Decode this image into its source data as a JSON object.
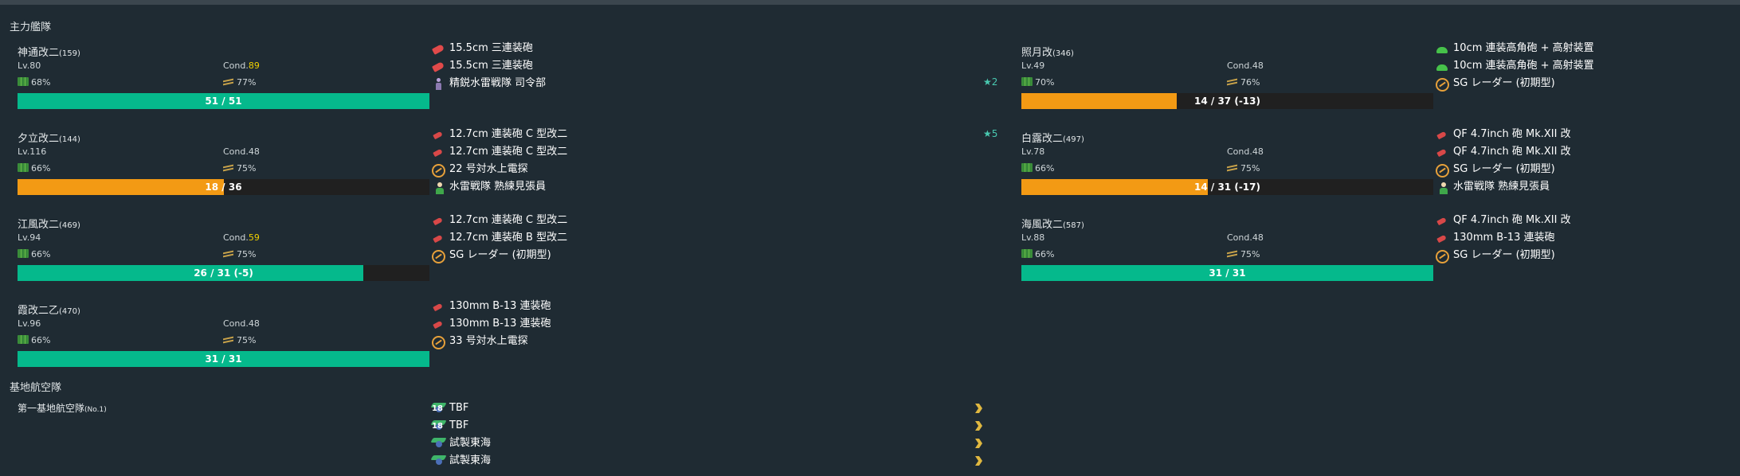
{
  "sections": {
    "main_fleet": "主力艦隊",
    "base_air": "基地航空隊"
  },
  "colors": {
    "hp_green": "#05b98c",
    "hp_orange": "#f39a14",
    "sparkle_yellow": "#f0d000",
    "proficiency_chevron": "#e0b840"
  },
  "ships": [
    {
      "name": "神通改二",
      "id": "(159)",
      "lv": "Lv.80",
      "cond_label": "Cond.",
      "cond": "89",
      "fuel": "68%",
      "ammo": "77%",
      "hp_text": "51 / 51",
      "hp_ratio": 1.0,
      "hp_color": "green",
      "equip": [
        {
          "icon": "main-gun-icon",
          "name": "15.5cm 三連装砲"
        },
        {
          "icon": "main-gun-icon",
          "name": "15.5cm 三連装砲"
        },
        {
          "icon": "fleet-command-icon",
          "name": "精鋭水雷戦隊 司令部"
        }
      ],
      "star": "★2"
    },
    {
      "name": "夕立改二",
      "id": "(144)",
      "lv": "Lv.116",
      "cond_label": "Cond.",
      "cond": "48",
      "fuel": "66%",
      "ammo": "75%",
      "hp_text": "18 / 36",
      "hp_ratio": 0.5,
      "hp_color": "orange",
      "equip": [
        {
          "icon": "small-gun-icon",
          "name": "12.7cm 連装砲 C 型改二"
        },
        {
          "icon": "small-gun-icon",
          "name": "12.7cm 連装砲 C 型改二"
        },
        {
          "icon": "radar-icon",
          "name": "22 号対水上電探"
        },
        {
          "icon": "lookout-icon",
          "name": "水雷戦隊 熟練見張員"
        }
      ],
      "star": "★5"
    },
    {
      "name": "江風改二",
      "id": "(469)",
      "lv": "Lv.94",
      "cond_label": "Cond.",
      "cond": "59",
      "fuel": "66%",
      "ammo": "75%",
      "hp_text": "26 / 31 (-5)",
      "hp_ratio": 0.839,
      "hp_color": "green",
      "equip": [
        {
          "icon": "small-gun-icon",
          "name": "12.7cm 連装砲 C 型改二"
        },
        {
          "icon": "small-gun-icon",
          "name": "12.7cm 連装砲 B 型改二"
        },
        {
          "icon": "radar-icon",
          "name": "SG レーダー (初期型)"
        }
      ]
    },
    {
      "name": "霞改二乙",
      "id": "(470)",
      "lv": "Lv.96",
      "cond_label": "Cond.",
      "cond": "48",
      "fuel": "66%",
      "ammo": "75%",
      "hp_text": "31 / 31",
      "hp_ratio": 1.0,
      "hp_color": "green",
      "equip": [
        {
          "icon": "small-gun-icon",
          "name": "130mm B-13 連装砲"
        },
        {
          "icon": "small-gun-icon",
          "name": "130mm B-13 連装砲"
        },
        {
          "icon": "radar-icon",
          "name": "33 号対水上電探"
        }
      ]
    },
    {
      "name": "照月改",
      "id": "(346)",
      "lv": "Lv.49",
      "cond_label": "Cond.",
      "cond": "48",
      "fuel": "70%",
      "ammo": "76%",
      "hp_text": "14 / 37 (-13)",
      "hp_ratio": 0.378,
      "hp_color": "orange",
      "equip": [
        {
          "icon": "aa-gun-icon",
          "name": "10cm 連装高角砲 + 高射装置"
        },
        {
          "icon": "aa-gun-icon",
          "name": "10cm 連装高角砲 + 高射装置"
        },
        {
          "icon": "radar-icon",
          "name": "SG レーダー (初期型)"
        }
      ]
    },
    {
      "name": "白露改二",
      "id": "(497)",
      "lv": "Lv.78",
      "cond_label": "Cond.",
      "cond": "48",
      "fuel": "66%",
      "ammo": "75%",
      "hp_text": "14 / 31 (-17)",
      "hp_ratio": 0.452,
      "hp_color": "orange",
      "equip": [
        {
          "icon": "small-gun-icon",
          "name": "QF 4.7inch 砲 Mk.XII 改"
        },
        {
          "icon": "small-gun-icon",
          "name": "QF 4.7inch 砲 Mk.XII 改"
        },
        {
          "icon": "radar-icon",
          "name": "SG レーダー (初期型)"
        },
        {
          "icon": "lookout-icon",
          "name": "水雷戦隊 熟練見張員"
        }
      ]
    },
    {
      "name": "海風改二",
      "id": "(587)",
      "lv": "Lv.88",
      "cond_label": "Cond.",
      "cond": "48",
      "fuel": "66%",
      "ammo": "75%",
      "hp_text": "31 / 31",
      "hp_ratio": 1.0,
      "hp_color": "green",
      "equip": [
        {
          "icon": "small-gun-icon",
          "name": "QF 4.7inch 砲 Mk.XII 改"
        },
        {
          "icon": "small-gun-icon",
          "name": "130mm B-13 連装砲"
        },
        {
          "icon": "radar-icon",
          "name": "SG レーダー (初期型)"
        }
      ]
    }
  ],
  "base_air": {
    "name": "第一基地航空隊",
    "no": "(No.1)",
    "squadrons": [
      {
        "icon": "torpedo-bomber-icon",
        "count": "18",
        "name": "TBF"
      },
      {
        "icon": "torpedo-bomber-icon",
        "count": "18",
        "name": "TBF"
      },
      {
        "icon": "land-bomber-icon",
        "count": "",
        "name": "試製東海"
      },
      {
        "icon": "land-bomber-icon",
        "count": "",
        "name": "試製東海"
      }
    ]
  }
}
